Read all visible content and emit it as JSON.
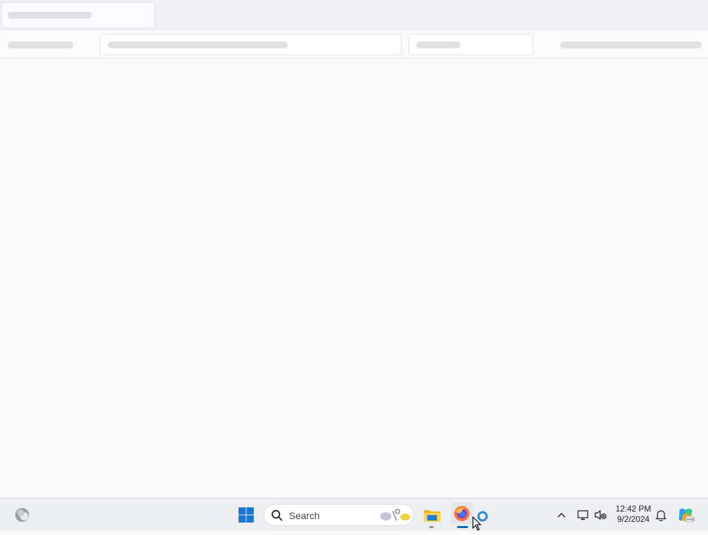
{
  "taskbar": {
    "search_placeholder": "Search",
    "clock_time": "12:42 PM",
    "clock_date": "9/2/2024",
    "icons": [
      "widgets-icon",
      "start-icon",
      "search-icon",
      "file-explorer-icon",
      "firefox-icon",
      "network-icon",
      "volume-muted-icon",
      "notifications-icon",
      "copilot-icon"
    ]
  },
  "colors": {
    "taskbar_bg": "#eeeff2",
    "accent": "#0067c0",
    "page_bg": "#f9f9f9"
  }
}
